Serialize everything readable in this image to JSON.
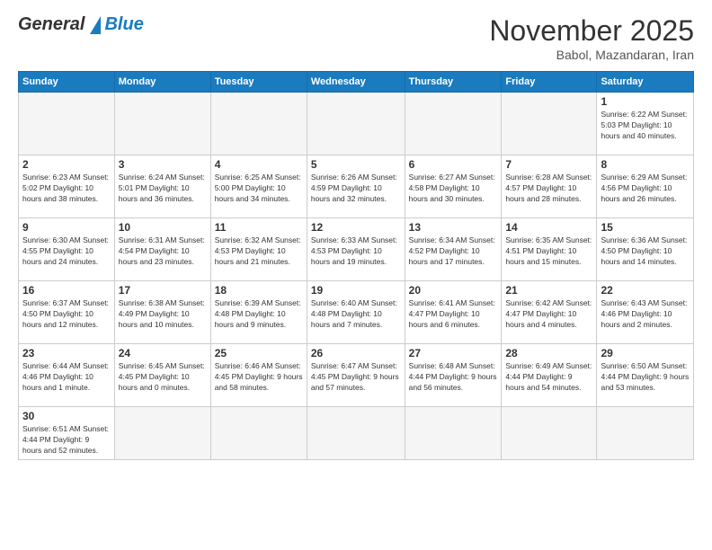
{
  "header": {
    "logo_general": "General",
    "logo_blue": "Blue",
    "month_title": "November 2025",
    "subtitle": "Babol, Mazandaran, Iran"
  },
  "days_of_week": [
    "Sunday",
    "Monday",
    "Tuesday",
    "Wednesday",
    "Thursday",
    "Friday",
    "Saturday"
  ],
  "weeks": [
    [
      {
        "day": "",
        "info": ""
      },
      {
        "day": "",
        "info": ""
      },
      {
        "day": "",
        "info": ""
      },
      {
        "day": "",
        "info": ""
      },
      {
        "day": "",
        "info": ""
      },
      {
        "day": "",
        "info": ""
      },
      {
        "day": "1",
        "info": "Sunrise: 6:22 AM\nSunset: 5:03 PM\nDaylight: 10 hours\nand 40 minutes."
      }
    ],
    [
      {
        "day": "2",
        "info": "Sunrise: 6:23 AM\nSunset: 5:02 PM\nDaylight: 10 hours\nand 38 minutes."
      },
      {
        "day": "3",
        "info": "Sunrise: 6:24 AM\nSunset: 5:01 PM\nDaylight: 10 hours\nand 36 minutes."
      },
      {
        "day": "4",
        "info": "Sunrise: 6:25 AM\nSunset: 5:00 PM\nDaylight: 10 hours\nand 34 minutes."
      },
      {
        "day": "5",
        "info": "Sunrise: 6:26 AM\nSunset: 4:59 PM\nDaylight: 10 hours\nand 32 minutes."
      },
      {
        "day": "6",
        "info": "Sunrise: 6:27 AM\nSunset: 4:58 PM\nDaylight: 10 hours\nand 30 minutes."
      },
      {
        "day": "7",
        "info": "Sunrise: 6:28 AM\nSunset: 4:57 PM\nDaylight: 10 hours\nand 28 minutes."
      },
      {
        "day": "8",
        "info": "Sunrise: 6:29 AM\nSunset: 4:56 PM\nDaylight: 10 hours\nand 26 minutes."
      }
    ],
    [
      {
        "day": "9",
        "info": "Sunrise: 6:30 AM\nSunset: 4:55 PM\nDaylight: 10 hours\nand 24 minutes."
      },
      {
        "day": "10",
        "info": "Sunrise: 6:31 AM\nSunset: 4:54 PM\nDaylight: 10 hours\nand 23 minutes."
      },
      {
        "day": "11",
        "info": "Sunrise: 6:32 AM\nSunset: 4:53 PM\nDaylight: 10 hours\nand 21 minutes."
      },
      {
        "day": "12",
        "info": "Sunrise: 6:33 AM\nSunset: 4:53 PM\nDaylight: 10 hours\nand 19 minutes."
      },
      {
        "day": "13",
        "info": "Sunrise: 6:34 AM\nSunset: 4:52 PM\nDaylight: 10 hours\nand 17 minutes."
      },
      {
        "day": "14",
        "info": "Sunrise: 6:35 AM\nSunset: 4:51 PM\nDaylight: 10 hours\nand 15 minutes."
      },
      {
        "day": "15",
        "info": "Sunrise: 6:36 AM\nSunset: 4:50 PM\nDaylight: 10 hours\nand 14 minutes."
      }
    ],
    [
      {
        "day": "16",
        "info": "Sunrise: 6:37 AM\nSunset: 4:50 PM\nDaylight: 10 hours\nand 12 minutes."
      },
      {
        "day": "17",
        "info": "Sunrise: 6:38 AM\nSunset: 4:49 PM\nDaylight: 10 hours\nand 10 minutes."
      },
      {
        "day": "18",
        "info": "Sunrise: 6:39 AM\nSunset: 4:48 PM\nDaylight: 10 hours\nand 9 minutes."
      },
      {
        "day": "19",
        "info": "Sunrise: 6:40 AM\nSunset: 4:48 PM\nDaylight: 10 hours\nand 7 minutes."
      },
      {
        "day": "20",
        "info": "Sunrise: 6:41 AM\nSunset: 4:47 PM\nDaylight: 10 hours\nand 6 minutes."
      },
      {
        "day": "21",
        "info": "Sunrise: 6:42 AM\nSunset: 4:47 PM\nDaylight: 10 hours\nand 4 minutes."
      },
      {
        "day": "22",
        "info": "Sunrise: 6:43 AM\nSunset: 4:46 PM\nDaylight: 10 hours\nand 2 minutes."
      }
    ],
    [
      {
        "day": "23",
        "info": "Sunrise: 6:44 AM\nSunset: 4:46 PM\nDaylight: 10 hours\nand 1 minute."
      },
      {
        "day": "24",
        "info": "Sunrise: 6:45 AM\nSunset: 4:45 PM\nDaylight: 10 hours\nand 0 minutes."
      },
      {
        "day": "25",
        "info": "Sunrise: 6:46 AM\nSunset: 4:45 PM\nDaylight: 9 hours\nand 58 minutes."
      },
      {
        "day": "26",
        "info": "Sunrise: 6:47 AM\nSunset: 4:45 PM\nDaylight: 9 hours\nand 57 minutes."
      },
      {
        "day": "27",
        "info": "Sunrise: 6:48 AM\nSunset: 4:44 PM\nDaylight: 9 hours\nand 56 minutes."
      },
      {
        "day": "28",
        "info": "Sunrise: 6:49 AM\nSunset: 4:44 PM\nDaylight: 9 hours\nand 54 minutes."
      },
      {
        "day": "29",
        "info": "Sunrise: 6:50 AM\nSunset: 4:44 PM\nDaylight: 9 hours\nand 53 minutes."
      }
    ],
    [
      {
        "day": "30",
        "info": "Sunrise: 6:51 AM\nSunset: 4:44 PM\nDaylight: 9 hours\nand 52 minutes."
      },
      {
        "day": "",
        "info": ""
      },
      {
        "day": "",
        "info": ""
      },
      {
        "day": "",
        "info": ""
      },
      {
        "day": "",
        "info": ""
      },
      {
        "day": "",
        "info": ""
      },
      {
        "day": "",
        "info": ""
      }
    ]
  ]
}
